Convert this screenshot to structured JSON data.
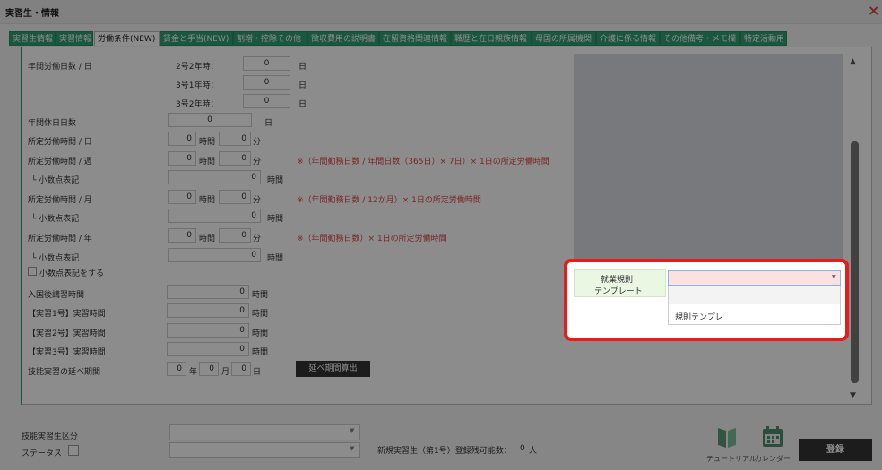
{
  "window": {
    "title": "実習生・情報",
    "close_icon": "×"
  },
  "tabs": [
    {
      "label": "実習生情報"
    },
    {
      "label": "実習情報"
    },
    {
      "label": "労働条件(NEW)"
    },
    {
      "label": "賃金と手当(NEW)"
    },
    {
      "label": "割増・控除その他"
    },
    {
      "label": "徴収費用の説明書"
    },
    {
      "label": "在留資格関連情報"
    },
    {
      "label": "職歴と在日親族情報"
    },
    {
      "label": "母国の所属機関"
    },
    {
      "label": "介護に係る情報"
    },
    {
      "label": "その他備考・メモ欄"
    },
    {
      "label": "特定活動用"
    }
  ],
  "form": {
    "annual_work_days": {
      "label": "年間労働日数 / 日",
      "rows": [
        {
          "label": "2号2年時：",
          "value": "0",
          "unit": "日"
        },
        {
          "label": "3号1年時：",
          "value": "0",
          "unit": "日"
        },
        {
          "label": "3号2年時：",
          "value": "0",
          "unit": "日"
        }
      ]
    },
    "annual_holidays": {
      "label": "年間休日日数",
      "value": "0",
      "unit": "日"
    },
    "daily_hours": {
      "label": "所定労働時間 / 日",
      "hours": "0",
      "minutes": "0",
      "h_unit": "時間",
      "m_unit": "分"
    },
    "weekly_hours": {
      "label": "所定労働時間 / 週",
      "hours": "0",
      "minutes": "0",
      "h_unit": "時間",
      "m_unit": "分",
      "note": "※（年間勤務日数 / 年間日数（365日）× 7日）× 1日の所定労働時間",
      "decimal_label": "└ 小数点表記",
      "decimal_value": "0",
      "decimal_unit": "時間"
    },
    "monthly_hours": {
      "label": "所定労働時間 / 月",
      "hours": "0",
      "minutes": "0",
      "h_unit": "時間",
      "m_unit": "分",
      "note": "※（年間勤務日数 / 12か月）× 1日の所定労働時間",
      "decimal_label": "└ 小数点表記",
      "decimal_value": "0",
      "decimal_unit": "時間"
    },
    "yearly_hours": {
      "label": "所定労働時間 / 年",
      "hours": "0",
      "minutes": "0",
      "h_unit": "時間",
      "m_unit": "分",
      "note": "※（年間勤務日数）× 1日の所定労働時間",
      "decimal_label": "└ 小数点表記",
      "decimal_value": "0",
      "decimal_unit": "時間"
    },
    "decimal_checkbox_label": "小数点表記をする",
    "training_hours": [
      {
        "label": "入国後講習時間",
        "value": "0",
        "unit": "時間"
      },
      {
        "label": "【実習1号】実習時間",
        "value": "0",
        "unit": "時間"
      },
      {
        "label": "【実習2号】実習時間",
        "value": "0",
        "unit": "時間"
      },
      {
        "label": "【実習3号】実習時間",
        "value": "0",
        "unit": "時間"
      }
    ],
    "extension": {
      "label": "技能実習の延べ期間",
      "years": "0",
      "y_unit": "年",
      "months": "0",
      "m_unit": "月",
      "days": "0",
      "d_unit": "日",
      "calc_button": "延べ期間算出"
    }
  },
  "popup": {
    "field_label_line1": "就業規則",
    "field_label_line2": "テンプレート",
    "selected_value": "",
    "options": [
      "",
      "規則テンプレ"
    ]
  },
  "bottom": {
    "trainee_category_label": "技能実習生区分",
    "status_label": "ステータス",
    "remaining_label": "新規実習生（第1号）登録残可能数：",
    "remaining_value": "0",
    "remaining_unit": "人",
    "tutorial_label": "チュートリアル",
    "calendar_label": "カレンダー",
    "register_button": "登録"
  },
  "colors": {
    "tab_green": "#2e9e73",
    "highlight_red": "#e81a1a",
    "note_red": "#d44",
    "select_pink": "#fde0e0"
  }
}
